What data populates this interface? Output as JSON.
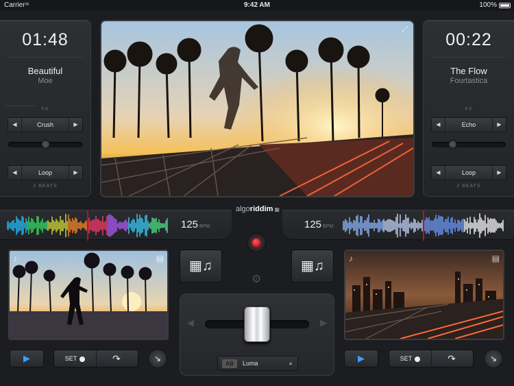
{
  "status_bar": {
    "carrier": "Carrier",
    "wifi_icon": "wifi-icon",
    "time": "9:42 AM",
    "battery": "100%"
  },
  "brand": {
    "prefix": "algo",
    "name": "riddim",
    "icon": "grid-icon"
  },
  "decks": {
    "left": {
      "time": "01:48",
      "title": "Beautiful",
      "artist": "Moe",
      "fx_label": "FX",
      "fx_effect": "Crush",
      "fx_level": 0.5,
      "loop_label": "Loop",
      "beats": "2 BEATS",
      "bpm": "125",
      "bpm_unit": "BPM",
      "wave_color": "rainbow"
    },
    "right": {
      "time": "00:22",
      "title": "The Flow",
      "artist": "Fourtastica",
      "fx_label": "FX",
      "fx_effect": "Echo",
      "fx_level": 0.25,
      "loop_label": "Loop",
      "beats": "2 BEATS",
      "bpm": "125",
      "bpm_unit": "BPM",
      "wave_color": "blue"
    }
  },
  "controls": {
    "set_label": "SET",
    "crossfader_position": 0.5,
    "transition_ab": "AB",
    "transition": "Luma"
  },
  "colors": {
    "accent": "#3aa0ff",
    "record": "#e0101e",
    "playhead": "#c01020"
  }
}
